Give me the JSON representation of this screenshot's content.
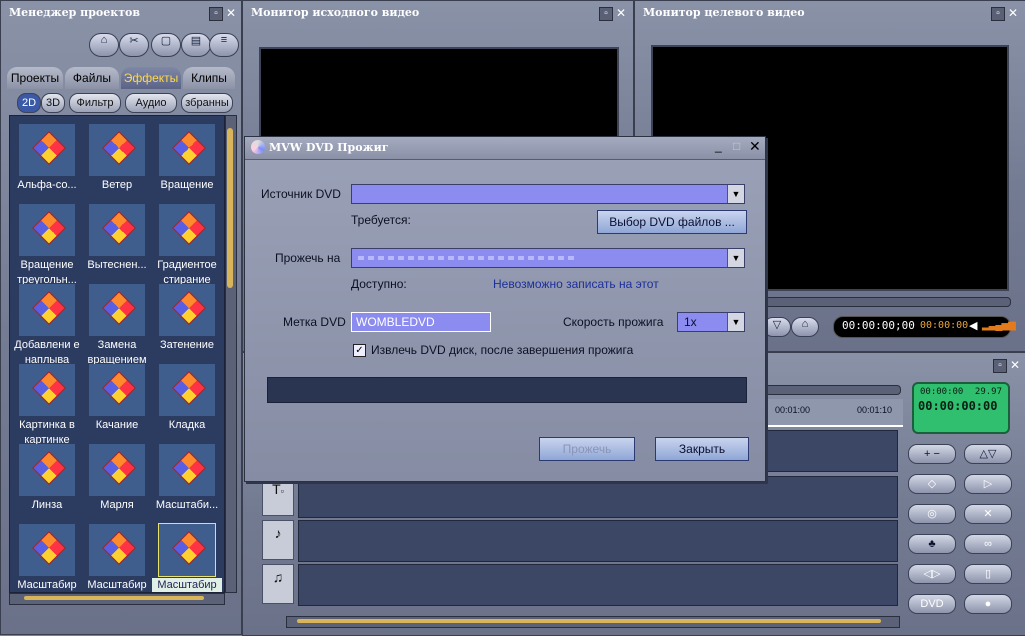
{
  "project_manager": {
    "title": "Менеджер проектов",
    "tabs": [
      {
        "label": "Проекты",
        "active": false
      },
      {
        "label": "Файлы",
        "active": false
      },
      {
        "label": "Эффекты",
        "active": true
      },
      {
        "label": "Клипы",
        "active": false
      }
    ],
    "filters": [
      {
        "label": "2D",
        "active": true
      },
      {
        "label": "3D",
        "active": false
      },
      {
        "label": "Фильтр",
        "active": false
      },
      {
        "label": "Аудио",
        "active": false
      },
      {
        "label": "збранны",
        "active": false
      }
    ],
    "effects": [
      "Альфа-со...",
      "Ветер",
      "Вращение",
      "Вращение треугольн...",
      "Вытеснен...",
      "Градиентое стирание",
      "Добавлени е наплыва",
      "Замена вращением",
      "Затенение",
      "Картинка в картинке",
      "Качание",
      "Кладка",
      "Линза",
      "Марля",
      "Масштаби...",
      "Масштабир",
      "Масштабир",
      "Масштабир"
    ],
    "selected_effect_index": 17
  },
  "source_monitor": {
    "title": "Монитор исходного видео"
  },
  "target_monitor": {
    "title": "Монитор целевого видео",
    "timecode": "00:00:00;00",
    "timecode_small": "00:00:00"
  },
  "timeline": {
    "ruler_marks": [
      "00:01:00",
      "00:01:10"
    ],
    "lcd_top_left": "00:00:00",
    "lcd_top_right": "29.97",
    "lcd_main": "00:00:00:00"
  },
  "dialog": {
    "title": "MVW DVD Прожиг",
    "source_label": "Источник DVD",
    "source_value": "",
    "required_label": "Требуется:",
    "select_files_button": "Выбор DVD файлов ...",
    "burn_to_label": "Прожечь на",
    "available_label": "Доступно:",
    "status_text": "Невозможно записать на этот",
    "disc_label_label": "Метка DVD",
    "disc_label_value": "WOMBLEDVD",
    "speed_label": "Скорость прожига",
    "speed_value": "1x",
    "eject_checkbox_label": "Извлечь DVD диск, после завершения прожига",
    "eject_checked": true,
    "burn_button": "Прожечь",
    "close_button": "Закрыть"
  },
  "colors": {
    "dialog_bg": "#9ba2b8",
    "combo_fill": "#8b8bf0",
    "status_blue": "#1d2f9a",
    "lcd_green": "#2fbf6f"
  }
}
